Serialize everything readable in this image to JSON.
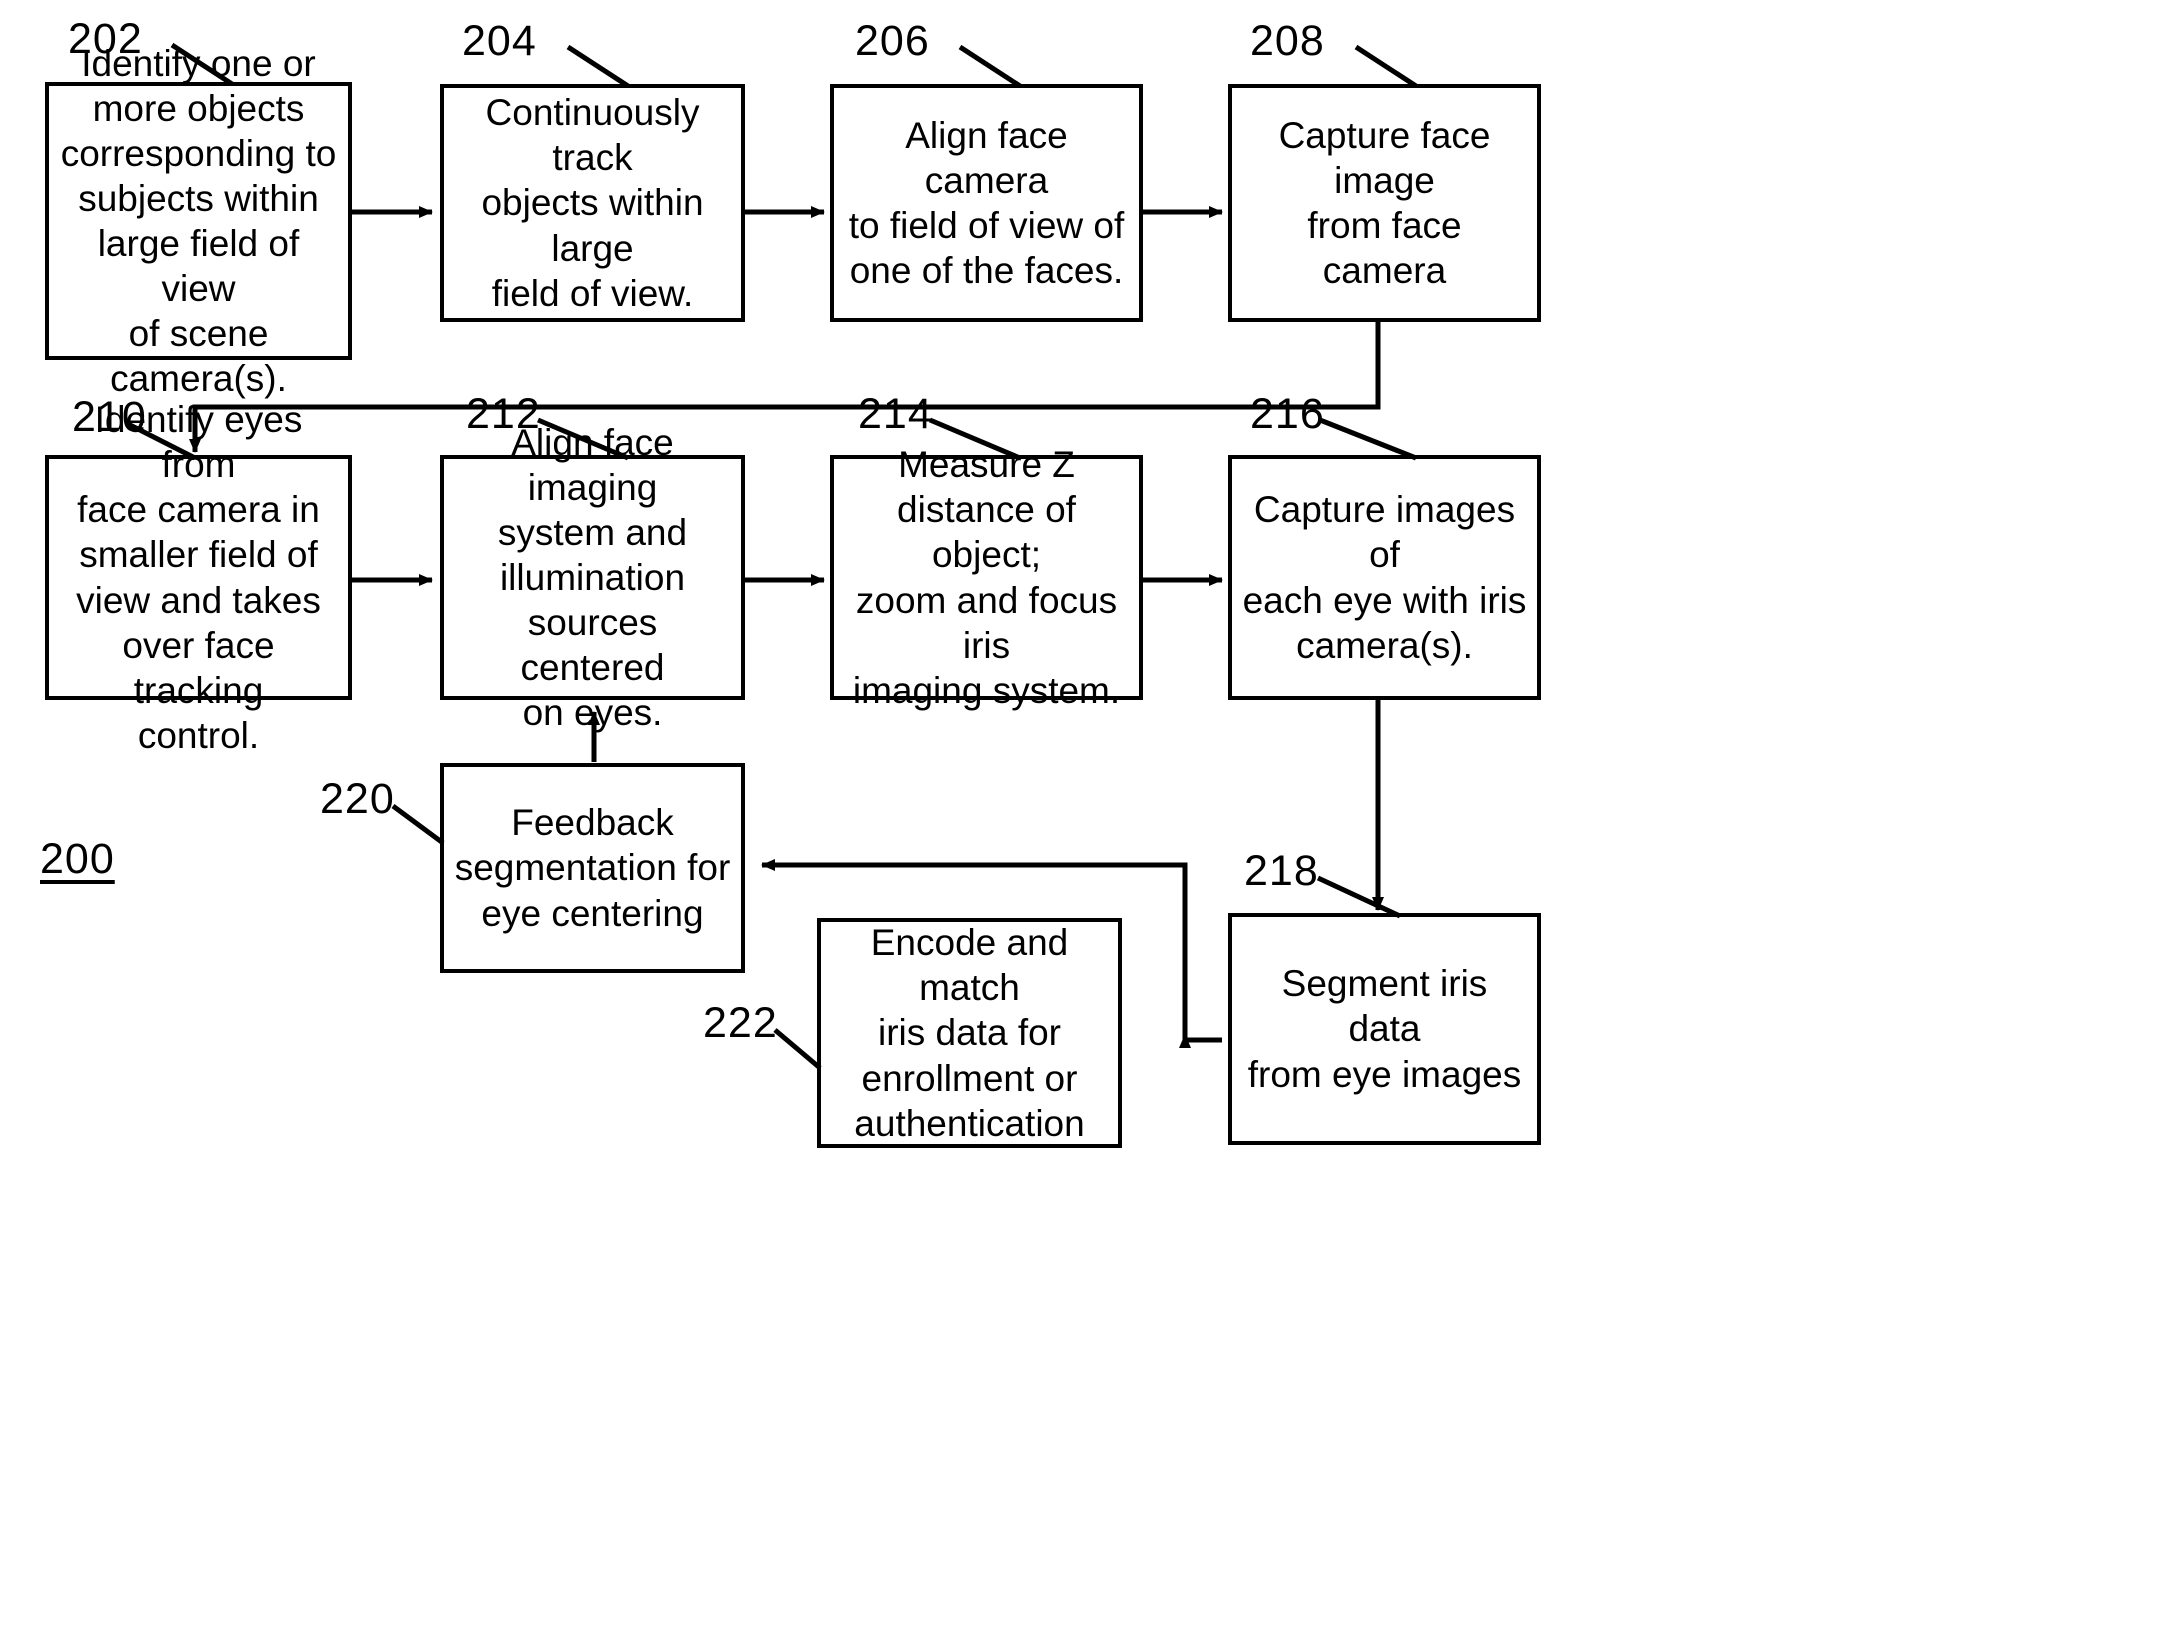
{
  "figure": {
    "label": "200",
    "boxes": [
      {
        "ref": "202",
        "text": "Identify one or\nmore objects\ncorresponding to\nsubjects within\nlarge field of view\nof scene\ncamera(s)."
      },
      {
        "ref": "204",
        "text": "Continuously track\nobjects within large\nfield of view."
      },
      {
        "ref": "206",
        "text": "Align face camera\nto field of view of\none of the faces."
      },
      {
        "ref": "208",
        "text": "Capture face image\nfrom face camera"
      },
      {
        "ref": "210",
        "text": "Identify eyes from\nface camera in\nsmaller field of\nview and takes\nover face tracking\ncontrol."
      },
      {
        "ref": "212",
        "text": "Align face imaging\nsystem and\nillumination\nsources centered\non eyes."
      },
      {
        "ref": "214",
        "text": "Measure Z\ndistance of object;\nzoom and focus iris\nimaging system."
      },
      {
        "ref": "216",
        "text": "Capture images of\neach eye with iris\ncamera(s)."
      },
      {
        "ref": "218",
        "text": "Segment iris data\nfrom eye images"
      },
      {
        "ref": "220",
        "text": "Feedback\nsegmentation for\neye centering"
      },
      {
        "ref": "222",
        "text": "Encode and match\niris data for\nenrollment or\nauthentication"
      }
    ]
  }
}
